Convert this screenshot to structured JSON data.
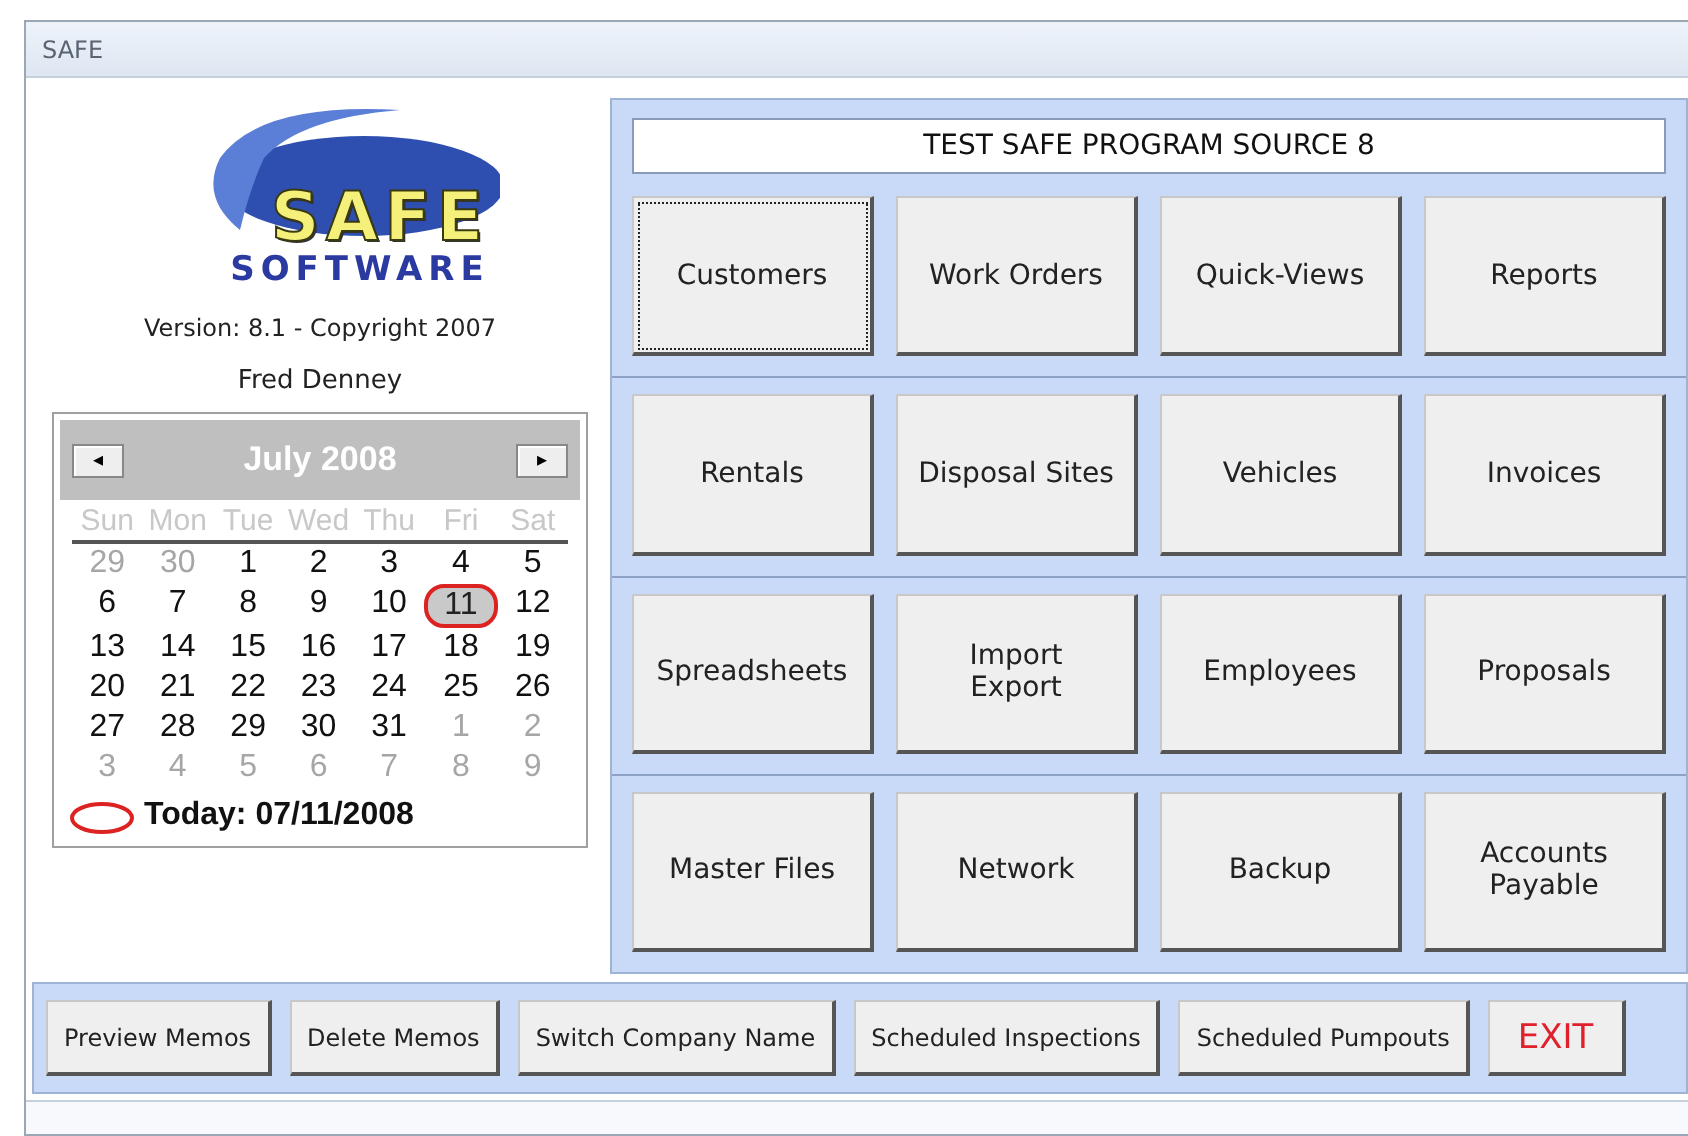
{
  "window": {
    "title": "SAFE"
  },
  "logo": {
    "word": "SAFE",
    "subword": "SOFTWARE"
  },
  "version": "Version: 8.1 - Copyright 2007",
  "user": "Fred Denney",
  "calendar": {
    "prev": "◂",
    "next": "▸",
    "month": "July 2008",
    "weekdays": [
      "Sun",
      "Mon",
      "Tue",
      "Wed",
      "Thu",
      "Fri",
      "Sat"
    ],
    "days": [
      {
        "label": "29",
        "muted": true,
        "selected": false
      },
      {
        "label": "30",
        "muted": true,
        "selected": false
      },
      {
        "label": "1",
        "muted": false,
        "selected": false
      },
      {
        "label": "2",
        "muted": false,
        "selected": false
      },
      {
        "label": "3",
        "muted": false,
        "selected": false
      },
      {
        "label": "4",
        "muted": false,
        "selected": false
      },
      {
        "label": "5",
        "muted": false,
        "selected": false
      },
      {
        "label": "6",
        "muted": false,
        "selected": false
      },
      {
        "label": "7",
        "muted": false,
        "selected": false
      },
      {
        "label": "8",
        "muted": false,
        "selected": false
      },
      {
        "label": "9",
        "muted": false,
        "selected": false
      },
      {
        "label": "10",
        "muted": false,
        "selected": false
      },
      {
        "label": "11",
        "muted": false,
        "selected": true
      },
      {
        "label": "12",
        "muted": false,
        "selected": false
      },
      {
        "label": "13",
        "muted": false,
        "selected": false
      },
      {
        "label": "14",
        "muted": false,
        "selected": false
      },
      {
        "label": "15",
        "muted": false,
        "selected": false
      },
      {
        "label": "16",
        "muted": false,
        "selected": false
      },
      {
        "label": "17",
        "muted": false,
        "selected": false
      },
      {
        "label": "18",
        "muted": false,
        "selected": false
      },
      {
        "label": "19",
        "muted": false,
        "selected": false
      },
      {
        "label": "20",
        "muted": false,
        "selected": false
      },
      {
        "label": "21",
        "muted": false,
        "selected": false
      },
      {
        "label": "22",
        "muted": false,
        "selected": false
      },
      {
        "label": "23",
        "muted": false,
        "selected": false
      },
      {
        "label": "24",
        "muted": false,
        "selected": false
      },
      {
        "label": "25",
        "muted": false,
        "selected": false
      },
      {
        "label": "26",
        "muted": false,
        "selected": false
      },
      {
        "label": "27",
        "muted": false,
        "selected": false
      },
      {
        "label": "28",
        "muted": false,
        "selected": false
      },
      {
        "label": "29",
        "muted": false,
        "selected": false
      },
      {
        "label": "30",
        "muted": false,
        "selected": false
      },
      {
        "label": "31",
        "muted": false,
        "selected": false
      },
      {
        "label": "1",
        "muted": true,
        "selected": false
      },
      {
        "label": "2",
        "muted": true,
        "selected": false
      },
      {
        "label": "3",
        "muted": true,
        "selected": false
      },
      {
        "label": "4",
        "muted": true,
        "selected": false
      },
      {
        "label": "5",
        "muted": true,
        "selected": false
      },
      {
        "label": "6",
        "muted": true,
        "selected": false
      },
      {
        "label": "7",
        "muted": true,
        "selected": false
      },
      {
        "label": "8",
        "muted": true,
        "selected": false
      },
      {
        "label": "9",
        "muted": true,
        "selected": false
      }
    ],
    "today": "Today: 07/11/2008"
  },
  "program_title": "TEST SAFE PROGRAM SOURCE 8",
  "menu_rows": [
    [
      {
        "label": "Customers",
        "focused": true
      },
      {
        "label": "Work Orders",
        "focused": false
      },
      {
        "label": "Quick-Views",
        "focused": false
      },
      {
        "label": "Reports",
        "focused": false
      }
    ],
    [
      {
        "label": "Rentals",
        "focused": false
      },
      {
        "label": "Disposal Sites",
        "focused": false
      },
      {
        "label": "Vehicles",
        "focused": false
      },
      {
        "label": "Invoices",
        "focused": false
      }
    ],
    [
      {
        "label": "Spreadsheets",
        "focused": false
      },
      {
        "label": "Import\nExport",
        "focused": false
      },
      {
        "label": "Employees",
        "focused": false
      },
      {
        "label": "Proposals",
        "focused": false
      }
    ],
    [
      {
        "label": "Master Files",
        "focused": false
      },
      {
        "label": "Network",
        "focused": false
      },
      {
        "label": "Backup",
        "focused": false
      },
      {
        "label": "Accounts\nPayable",
        "focused": false
      }
    ]
  ],
  "bottom_buttons": [
    {
      "label": "Preview Memos",
      "kind": "normal"
    },
    {
      "label": "Delete Memos",
      "kind": "normal"
    },
    {
      "label": "Switch Company Name",
      "kind": "normal"
    },
    {
      "label": "Scheduled Inspections",
      "kind": "normal"
    },
    {
      "label": "Scheduled Pumpouts",
      "kind": "normal"
    },
    {
      "label": "EXIT",
      "kind": "exit"
    }
  ]
}
